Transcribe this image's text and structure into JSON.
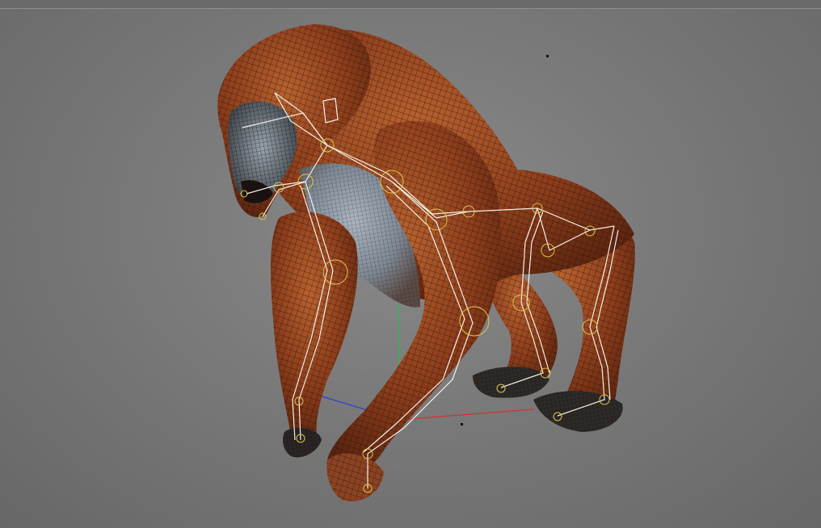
{
  "viewport": {
    "mode": "perspective",
    "object": "gorilla-rig",
    "display": "textured-wireframe-with-skeleton"
  },
  "colors": {
    "background": "#7b7b7b",
    "fur_dark": "#5a240f",
    "fur_mid": "#8f3f1c",
    "fur_light": "#b8622f",
    "chest_skin": "#8b97a3",
    "wire": "#1c0d06",
    "bone": "#f3f0e6",
    "joint": "#e0c64a",
    "axis_x": "#d43030",
    "axis_y": "#2fb84a",
    "axis_z": "#2b3fd6"
  }
}
